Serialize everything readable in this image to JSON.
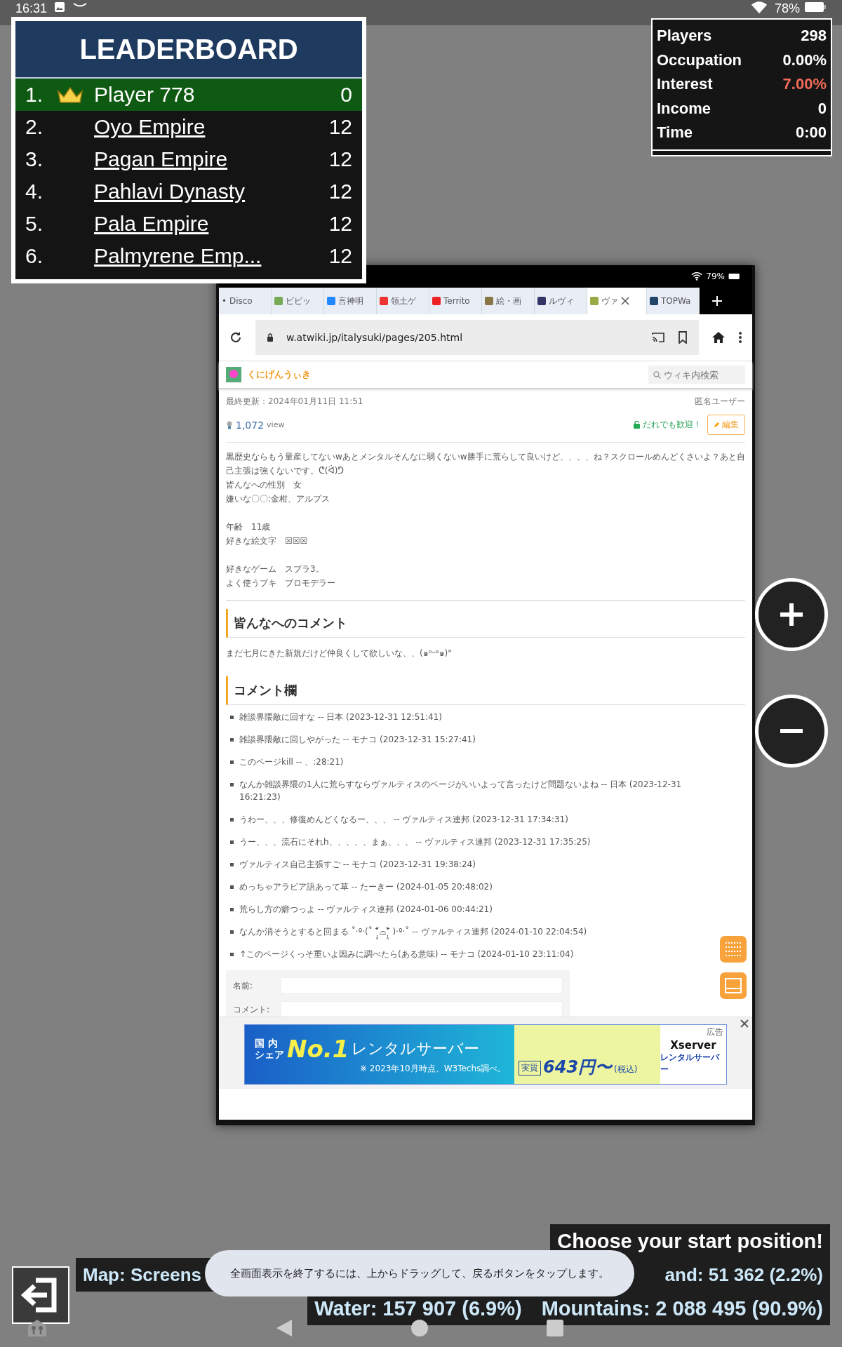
{
  "status_bar": {
    "time": "16:31",
    "battery": "78%"
  },
  "leaderboard": {
    "title": "LEADERBOARD",
    "rows": [
      {
        "rank": "1.",
        "name": "Player 778",
        "score": "0",
        "selected": true
      },
      {
        "rank": "2.",
        "name": "Oyo Empire",
        "score": "12",
        "selected": false
      },
      {
        "rank": "3.",
        "name": "Pagan Empire",
        "score": "12",
        "selected": false
      },
      {
        "rank": "4.",
        "name": "Pahlavi Dynasty",
        "score": "12",
        "selected": false
      },
      {
        "rank": "5.",
        "name": "Pala Empire",
        "score": "12",
        "selected": false
      },
      {
        "rank": "6.",
        "name": "Palmyrene Emp...",
        "score": "12",
        "selected": false
      }
    ]
  },
  "stats": [
    {
      "label": "Players",
      "value": "298",
      "alert": false
    },
    {
      "label": "Occupation",
      "value": "0.00%",
      "alert": false
    },
    {
      "label": "Interest",
      "value": "7.00%",
      "alert": true
    },
    {
      "label": "Income",
      "value": "0",
      "alert": false
    },
    {
      "label": "Time",
      "value": "0:00",
      "alert": false
    }
  ],
  "map_screenshot": {
    "battery": "79%",
    "tabs": [
      {
        "label": "• Disco",
        "selected": false
      },
      {
        "label": "ビビッ",
        "selected": false
      },
      {
        "label": "言神明",
        "selected": false
      },
      {
        "label": "領土ゲ",
        "selected": false
      },
      {
        "label": "Territo",
        "selected": false
      },
      {
        "label": "絵・画",
        "selected": false
      },
      {
        "label": "ルヴィ",
        "selected": false
      },
      {
        "label": "ヴァ",
        "selected": true
      },
      {
        "label": "TOPWa",
        "selected": false
      }
    ],
    "url": "w.atwiki.jp/italysuki/pages/205.html",
    "site_name": "くにげんうぃき",
    "search": {
      "placeholder": "ウィキ内検索"
    },
    "updated": "最終更新：2024年01月11日 11:51",
    "author": "匿名ユーザー",
    "views": "1,072",
    "views_unit": "view",
    "welcome": "だれでも歓迎！",
    "edit_button": "編集",
    "body": [
      {
        "lines": [
          "黒歴史ならもう量産してないwあとメンタルそんなに弱くないw勝手に荒らして良いけど、、、、ね？スクロールめんどくさいよ？あと自己主張は強くないです。ᕦ(ᐛ)ᕤ",
          "皆んなへの性別　女",
          "嫌いな〇〇:金柑、アルプス"
        ]
      },
      {
        "lines": [
          "年齢　11歳",
          "好きな絵文字　☒☒☒"
        ]
      },
      {
        "lines": [
          "好きなゲーム　スプラ3。",
          "よく使うブキ　プロモデラー"
        ]
      }
    ],
    "section1": {
      "heading": "皆んなへのコメント",
      "text": "まだ七月にきた新規だけど仲良くして欲しいな、、(๑ᵒᵕᵒ๑)\""
    },
    "section2": {
      "heading": "コメント欄",
      "comments": [
        "雑談界隈敵に回すな -- 日本 (2023-12-31 12:51:41)",
        "雑談界隈敵に回しやがった -- モナコ (2023-12-31 15:27:41)",
        "このページkill -- 、:28:21)",
        "なんか雑談界隈の1人に荒らすならヴァルティスのページがいいよって言ったけど問題ないよね -- 日本 (2023-12-31 16:21:23)",
        "うわー、、、修復めんどくなるー、、、 -- ヴァルティス連邦 (2023-12-31 17:34:31)",
        "うー、、、流石にそれh、、、、、まぁ、、、 -- ヴァルティス連邦 (2023-12-31 17:35:25)",
        "ヴァルティス自己主張すご -- モナコ (2023-12-31 19:38:24)",
        "めっちゃアラビア語あって草 -- たーきー (2024-01-05 20:48:02)",
        "荒らし方の癖つっよ -- ヴァルティス連邦 (2024-01-06 00:44:21)",
        "なんか消そうとすると回まる ˚‧º·(˚ ˃̣̣̥᷄⌓˂̣̣̥᷅ )‧º·˚ -- ヴァルティス連邦 (2024-01-10 22:04:54)",
        "↑このページくっそ重いよ因みに調べたら(ある意味) -- モナコ (2024-01-10 23:11:04)"
      ]
    },
    "form": {
      "name_label": "名前:",
      "comment_label": "コメント:"
    },
    "ad": {
      "label": "広告",
      "share_1": "国 内",
      "share_2": "シェア",
      "rank": "No.1",
      "product": "レンタルサーバー",
      "note": "※ 2023年10月時点、W3Techs調べ。",
      "price_tag": "実質",
      "price": "643円〜",
      "tax": "(税込)",
      "brand": "Xserver",
      "brand_sub": "レンタルサーバー"
    }
  },
  "info": {
    "prompt": "Choose your start position!",
    "map_left": "Map: Screens",
    "map_right": "and: 51 362 (2.2%)",
    "water": "Water: 157 907 (6.9%)",
    "mountains": "Mountains: 2 088 495 (90.9%)"
  },
  "toast": "全画面表示を終了するには、上からドラッグして、戻るボタンをタップします。"
}
